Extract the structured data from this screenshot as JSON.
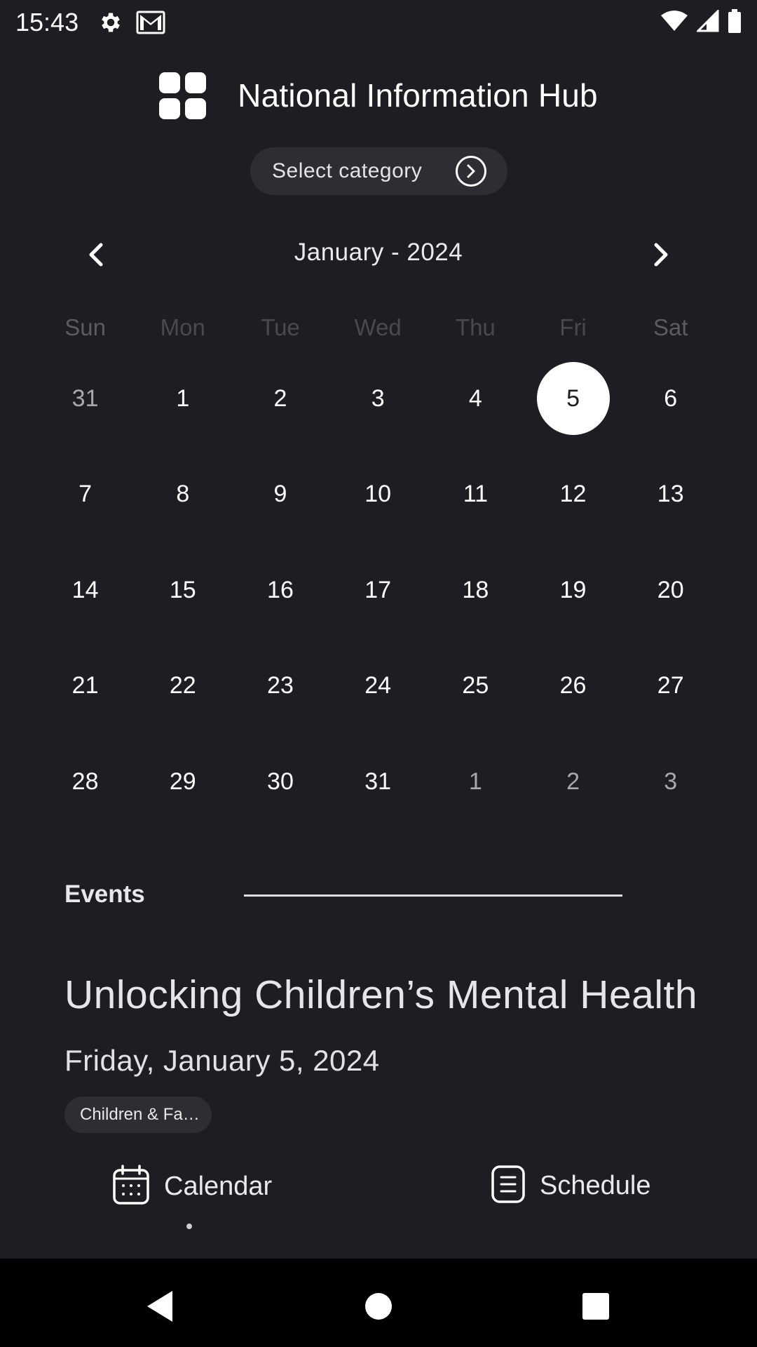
{
  "status_bar": {
    "time": "15:43",
    "icons": [
      "gear-icon",
      "gmail-icon",
      "wifi-icon",
      "signal-icon",
      "battery-icon"
    ]
  },
  "header": {
    "title": "National Information Hub",
    "logo_icon": "four-squares-logo"
  },
  "category": {
    "label": "Select category",
    "icon": "chevron-right-circle-icon"
  },
  "calendar": {
    "month_label": "January - 2024",
    "weekdays": [
      "Sun",
      "Mon",
      "Tue",
      "Wed",
      "Thu",
      "Fri",
      "Sat"
    ],
    "weeks": [
      [
        "31",
        "1",
        "2",
        "3",
        "4",
        "5",
        "6"
      ],
      [
        "7",
        "8",
        "9",
        "10",
        "11",
        "12",
        "13"
      ],
      [
        "14",
        "15",
        "16",
        "17",
        "18",
        "19",
        "20"
      ],
      [
        "21",
        "22",
        "23",
        "24",
        "25",
        "26",
        "27"
      ],
      [
        "28",
        "29",
        "30",
        "31",
        "1",
        "2",
        "3"
      ]
    ],
    "selected_day": "5"
  },
  "events": {
    "section_title": "Events",
    "event_title": "Unlocking Children’s Mental Health",
    "event_date": "Friday, January 5, 2024",
    "event_tag": "Children & Fa…"
  },
  "tabs": {
    "calendar_label": "Calendar",
    "schedule_label": "Schedule",
    "active": "Calendar"
  },
  "colors": {
    "background": "#1e1d22",
    "pill": "#2e2d33",
    "selected_day_bg": "#ffffff",
    "nav_bar": "#000000"
  }
}
